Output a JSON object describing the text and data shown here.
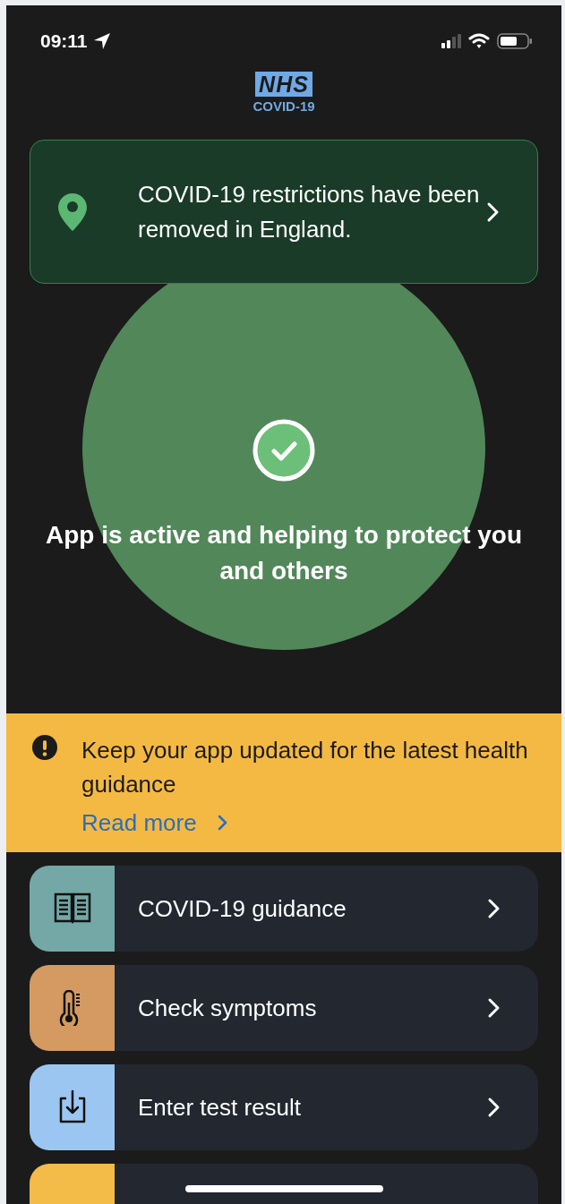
{
  "status_bar": {
    "time": "09:11"
  },
  "logo": {
    "mark": "NHS",
    "subtitle": "COVID-19"
  },
  "notice": {
    "text": "COVID-19 restrictions have been removed in England."
  },
  "status": {
    "text": "App is active and helping to protect you and others"
  },
  "banner": {
    "text": "Keep your app updated for the latest health guidance",
    "link": "Read more"
  },
  "menu": [
    {
      "label": "COVID-19 guidance",
      "kind": "book",
      "color": "#73a8a6"
    },
    {
      "label": "Check symptoms",
      "kind": "thermometer",
      "color": "#d49a62"
    },
    {
      "label": "Enter test result",
      "kind": "download",
      "color": "#9cc6f2"
    },
    {
      "kind": "none",
      "color": "#f3bb47"
    }
  ]
}
